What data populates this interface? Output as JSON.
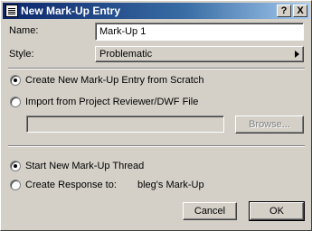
{
  "window": {
    "title": "New Mark-Up Entry",
    "help_label": "?",
    "close_label": "X"
  },
  "form": {
    "name_label": "Name:",
    "name_value": "Mark-Up 1",
    "style_label": "Style:",
    "style_value": "Problematic"
  },
  "options": {
    "create_new": "Create New Mark-Up Entry from Scratch",
    "import": "Import from Project Reviewer/DWF File",
    "browse_label": "Browse..."
  },
  "thread": {
    "start_new": "Start New Mark-Up Thread",
    "create_response": "Create Response to:",
    "response_target": "bleg's Mark-Up"
  },
  "buttons": {
    "cancel": "Cancel",
    "ok": "OK"
  }
}
